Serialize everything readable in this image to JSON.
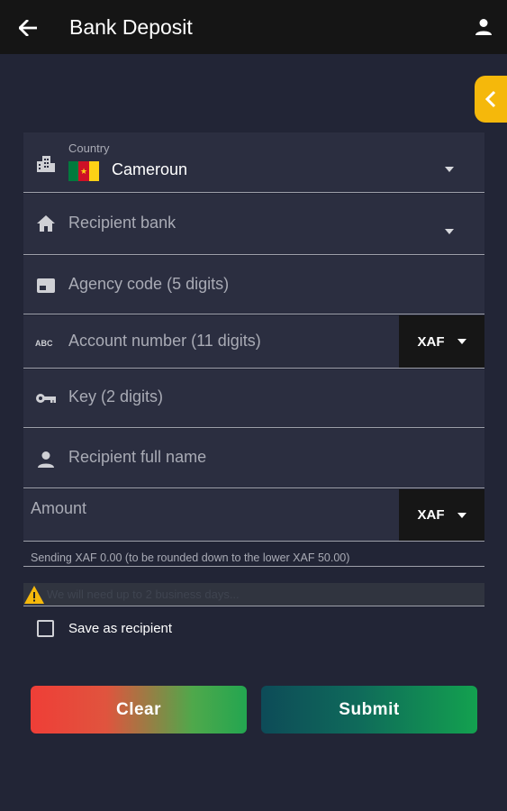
{
  "header": {
    "title": "Bank Deposit",
    "back_icon": "arrow-left-icon",
    "profile_icon": "person-icon"
  },
  "drawer": {
    "icon": "chevron-left-icon",
    "color": "#f5b80b"
  },
  "form": {
    "country": {
      "small_label": "Country",
      "value": "Cameroun",
      "icon": "city-icon",
      "flag_colors": [
        "#007a3d",
        "#ce1126",
        "#fcd116"
      ]
    },
    "recipient_bank": {
      "placeholder": "Recipient bank",
      "icon": "bank-icon"
    },
    "agency_code": {
      "placeholder": "Agency code (5 digits)",
      "icon": "card-icon"
    },
    "account_number": {
      "placeholder": "Account number (11 digits)",
      "icon": "abc-icon",
      "currency": "XAF"
    },
    "key": {
      "placeholder": "Key (2 digits)",
      "icon": "key-icon"
    },
    "recipient_name": {
      "placeholder": "Recipient full name",
      "icon": "person-icon"
    },
    "amount": {
      "placeholder": "Amount",
      "currency": "XAF"
    }
  },
  "sending_note": "Sending  XAF 0.00  (to be rounded down to the lower XAF 50.00)",
  "warning": {
    "text": "We will need up to 2 business days...",
    "icon": "warning-icon"
  },
  "save_recipient": {
    "label": "Save as recipient",
    "checked": false
  },
  "buttons": {
    "clear": "Clear",
    "submit": "Submit"
  },
  "colors": {
    "background": "#222536",
    "field": "#2b2e40",
    "topbar": "#151515"
  }
}
